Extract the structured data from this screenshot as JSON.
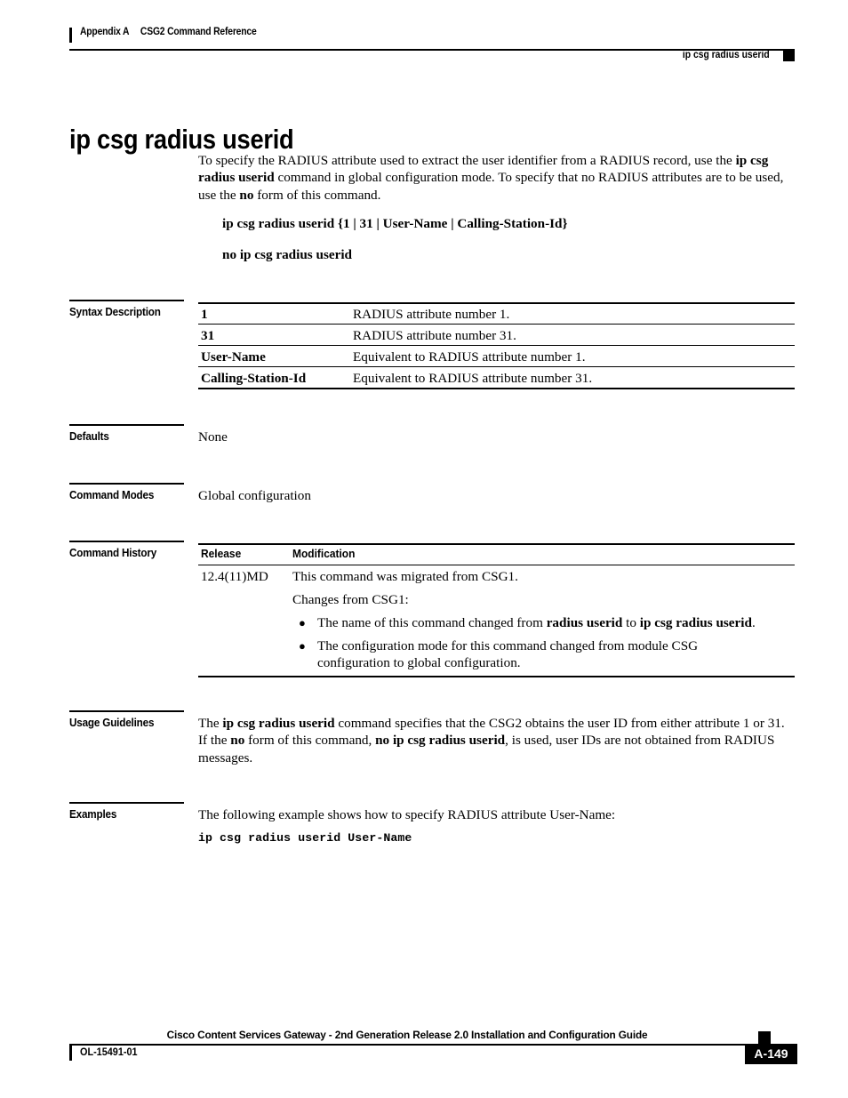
{
  "header": {
    "appendix": "Appendix A",
    "section": "CSG2 Command Reference",
    "running_command": "ip csg radius userid"
  },
  "title": "ip csg radius userid",
  "intro": {
    "part1": "To specify the RADIUS attribute used to extract the user identifier from a RADIUS record, use the ",
    "bold1": "ip csg radius userid",
    "part2": " command in global configuration mode. To specify that no RADIUS attributes are to be used, use the ",
    "bold2": "no",
    "part3": " form of this command."
  },
  "syntax": {
    "line1": "ip csg radius userid {1 | 31 | User-Name | Calling-Station-Id}",
    "line2": "no ip csg radius userid"
  },
  "sections": {
    "syntax_description": "Syntax Description",
    "defaults": "Defaults",
    "command_modes": "Command Modes",
    "command_history": "Command History",
    "usage_guidelines": "Usage Guidelines",
    "examples": "Examples"
  },
  "syntax_table": {
    "rows": [
      {
        "term": "1",
        "desc": "RADIUS attribute number 1."
      },
      {
        "term": "31",
        "desc": "RADIUS attribute number 31."
      },
      {
        "term": "User-Name",
        "desc": "Equivalent to RADIUS attribute number 1."
      },
      {
        "term": "Calling-Station-Id",
        "desc": "Equivalent to RADIUS attribute number 31."
      }
    ]
  },
  "defaults_value": "None",
  "command_modes_value": "Global configuration",
  "command_history": {
    "col_release": "Release",
    "col_modification": "Modification",
    "release": "12.4(11)MD",
    "mod_line1": "This command was migrated from CSG1.",
    "mod_line2": "Changes from CSG1:",
    "bullets": [
      {
        "pre": "The name of this command changed from ",
        "bold1": "radius userid",
        "mid": " to ",
        "bold2": "ip csg radius userid",
        "post": "."
      },
      {
        "text": "The configuration mode for this command changed from module CSG configuration to global configuration."
      }
    ]
  },
  "usage": {
    "pre": "The ",
    "bold1": "ip csg radius userid",
    "mid1": " command specifies that the CSG2 obtains the user ID from either attribute 1 or 31. If the ",
    "bold2": "no",
    "mid2": " form of this command, ",
    "bold3": "no ip csg radius userid",
    "post": ", is used, user IDs are not obtained from RADIUS messages."
  },
  "examples": {
    "intro": "The following example shows how to specify RADIUS attribute User-Name:",
    "code": "ip csg radius userid User-Name"
  },
  "footer": {
    "title": "Cisco Content Services Gateway - 2nd Generation Release 2.0 Installation and Configuration Guide",
    "doc_id": "OL-15491-01",
    "page": "A-149"
  }
}
